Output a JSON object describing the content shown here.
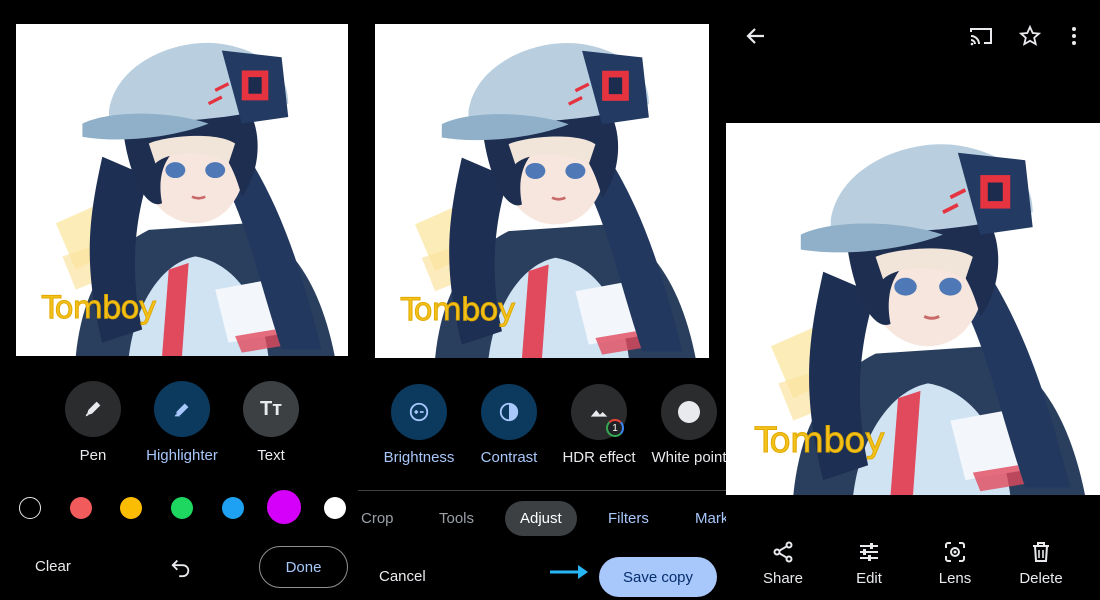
{
  "watermark_text": "Tomboy",
  "markup_panel": {
    "tools": [
      {
        "label": "Pen",
        "icon": "pen-icon",
        "active": false
      },
      {
        "label": "Highlighter",
        "icon": "highlighter-icon",
        "active": true
      },
      {
        "label": "Text",
        "icon": "text-tool-icon",
        "active": false
      }
    ],
    "text_tool_glyph": "Tт",
    "colors": [
      "#000000",
      "#f25b5b",
      "#fbbc04",
      "#1ed760",
      "#1ea1f2",
      "#d500f9",
      "#ffffff"
    ],
    "selected_color": "#d500f9",
    "clear_label": "Clear",
    "done_label": "Done"
  },
  "adjust_panel": {
    "adjustments": [
      {
        "label": "Brightness",
        "icon": "brightness-icon",
        "active": true
      },
      {
        "label": "Contrast",
        "icon": "contrast-icon",
        "active": true
      },
      {
        "label": "HDR effect",
        "icon": "hdr-icon",
        "active": false,
        "badge": "1"
      },
      {
        "label": "White point",
        "icon": "white-point-icon",
        "active": false
      }
    ],
    "tabs": [
      {
        "label": "Crop",
        "state": "normal"
      },
      {
        "label": "Tools",
        "state": "normal"
      },
      {
        "label": "Adjust",
        "state": "selected"
      },
      {
        "label": "Filters",
        "state": "highlight"
      },
      {
        "label": "Markup",
        "state": "highlight"
      }
    ],
    "cancel_label": "Cancel",
    "save_copy_label": "Save copy"
  },
  "viewer_panel": {
    "actions": [
      {
        "label": "Share",
        "icon": "share-icon"
      },
      {
        "label": "Edit",
        "icon": "edit-sliders-icon"
      },
      {
        "label": "Lens",
        "icon": "lens-icon"
      },
      {
        "label": "Delete",
        "icon": "delete-icon"
      }
    ]
  },
  "colors": {
    "accent": "#a8c7fa",
    "active_circle": "#0b3a5e",
    "inactive_circle": "#2a2c2e",
    "arrow": "#29b6f6"
  }
}
